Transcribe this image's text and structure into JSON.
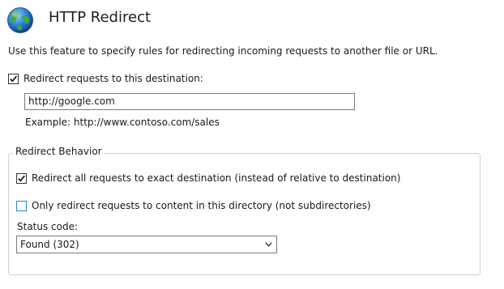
{
  "header": {
    "title": "HTTP Redirect",
    "icon": "globe-icon"
  },
  "description": "Use this feature to specify rules for redirecting incoming requests to another file or URL.",
  "redirect": {
    "checkbox_label": "Redirect requests to this destination:",
    "checked": true,
    "destination_value": "http://google.com",
    "example": "Example: http://www.contoso.com/sales"
  },
  "behavior": {
    "legend": "Redirect Behavior",
    "exact_label": "Redirect all requests to exact destination (instead of relative to destination)",
    "exact_checked": true,
    "directory_label": "Only redirect requests to content in this directory (not subdirectories)",
    "directory_checked": false,
    "status_label": "Status code:",
    "status_value": "Found (302)"
  },
  "colors": {
    "globe_ocean": "#1a6fc4",
    "globe_land": "#3fa53a",
    "checkbox_unchecked_border": "#3c7fb1"
  }
}
